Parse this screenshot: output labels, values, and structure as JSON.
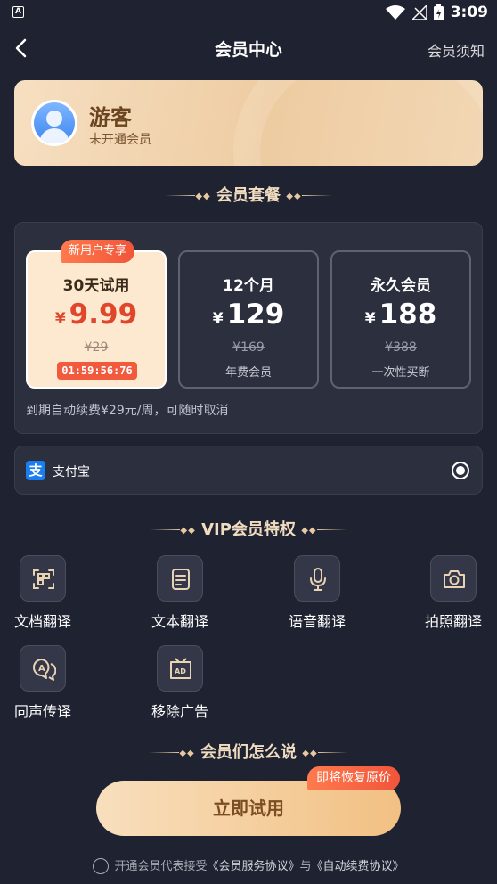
{
  "status_bar": {
    "left_icon": "A",
    "time": "3:09"
  },
  "nav": {
    "title": "会员中心",
    "right_link": "会员须知"
  },
  "user": {
    "name": "游客",
    "status": "未开通会员"
  },
  "plans_section": {
    "title": "会员套餐",
    "plans": [
      {
        "badge": "新用户专享",
        "name": "30天试用",
        "currency": "¥",
        "price": "9.99",
        "original": "¥29",
        "timer": "01:59:56:76",
        "selected": true
      },
      {
        "name": "12个月",
        "currency": "¥",
        "price": "129",
        "original": "¥169",
        "subtitle": "年费会员"
      },
      {
        "name": "永久会员",
        "currency": "¥",
        "price": "188",
        "original": "¥388",
        "subtitle": "一次性买断"
      }
    ],
    "renew_note": "到期自动续费¥29元/周，可随时取消"
  },
  "payment": {
    "icon": "alipay-icon",
    "method": "支付宝"
  },
  "vip_section": {
    "title": "VIP会员特权",
    "features": [
      {
        "icon": "document-scan-icon",
        "label": "文档翻译"
      },
      {
        "icon": "text-file-icon",
        "label": "文本翻译"
      },
      {
        "icon": "microphone-icon",
        "label": "语音翻译"
      },
      {
        "icon": "camera-icon",
        "label": "拍照翻译"
      },
      {
        "icon": "simultaneous-translate-icon",
        "label": "同声传译"
      },
      {
        "icon": "ad-remove-icon",
        "label": "移除广告"
      }
    ]
  },
  "reviews_section": {
    "title": "会员们怎么说"
  },
  "cta": {
    "label": "立即试用",
    "badge": "即将恢复原价"
  },
  "agreement": {
    "prefix": "开通会员代表接受",
    "service": "《会员服务协议》",
    "and": "与",
    "auto_renew": "《自动续费协议》"
  },
  "colors": {
    "background": "#1f2230",
    "accent": "#f0553a",
    "gold": "#f2c083"
  }
}
